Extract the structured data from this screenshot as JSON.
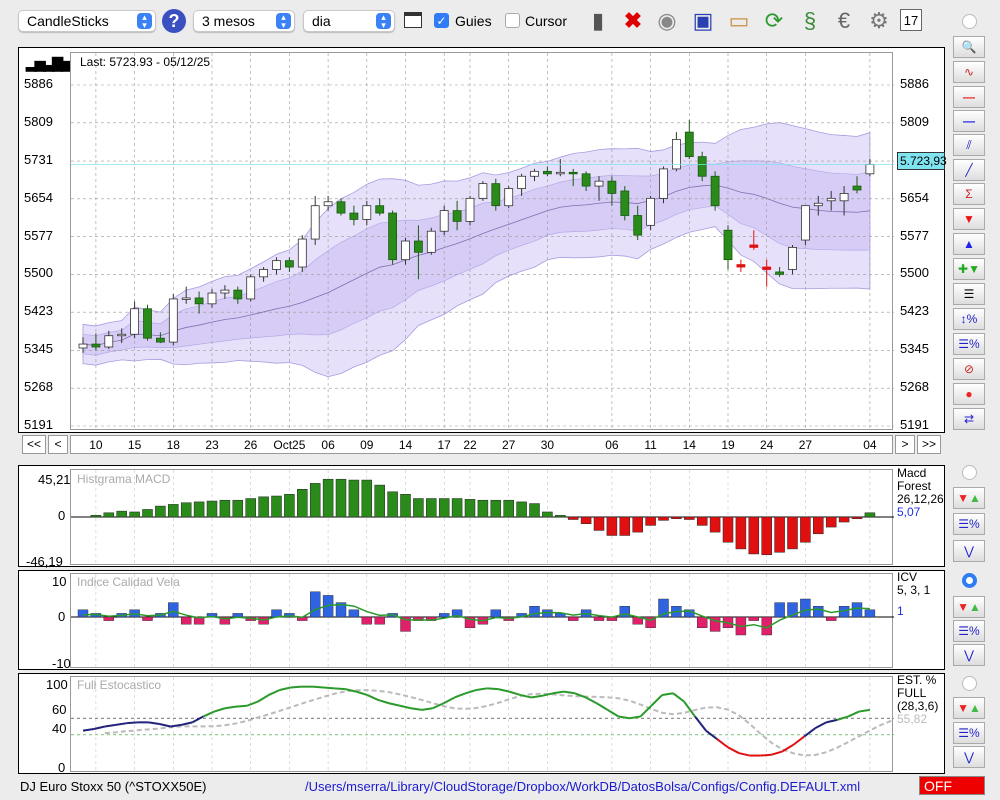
{
  "toolbar": {
    "chart_type": "CandleSticks",
    "period": "3 mesos",
    "interval": "dia",
    "guides_label": "Guies",
    "guides_checked": true,
    "cursor_label": "Cursor",
    "cursor_checked": false,
    "icons": [
      "trash-icon",
      "delete-icon",
      "lamp-icon",
      "save-icon",
      "open-folder-icon",
      "refresh-icon",
      "sync-icon",
      "euro-icon",
      "settings-icon",
      "calendar-icon"
    ]
  },
  "main": {
    "last_label": "Last: 5723.93 - 05/12/25",
    "current_price": "5.723,93",
    "price_ticks": [
      "5886",
      "5809",
      "5731",
      "5654",
      "5577",
      "5500",
      "5423",
      "5345",
      "5268",
      "5191"
    ]
  },
  "nav": {
    "first": "<<",
    "prev": "<",
    "next": ">",
    "last": ">>"
  },
  "chart_data": [
    {
      "type": "candlestick",
      "title": "Last: 5723.93 - 05/12/25",
      "ylim": [
        5191,
        5886
      ],
      "yticks": [
        5886,
        5809,
        5731,
        5654,
        5577,
        5500,
        5423,
        5345,
        5268,
        5191
      ],
      "xticks": [
        {
          "i": 1,
          "label": "10"
        },
        {
          "i": 4,
          "label": "15"
        },
        {
          "i": 7,
          "label": "18"
        },
        {
          "i": 10,
          "label": "23"
        },
        {
          "i": 13,
          "label": "26"
        },
        {
          "i": 16,
          "label": "Oct25"
        },
        {
          "i": 19,
          "label": "06"
        },
        {
          "i": 22,
          "label": "09"
        },
        {
          "i": 25,
          "label": "14"
        },
        {
          "i": 28,
          "label": "17"
        },
        {
          "i": 30,
          "label": "22"
        },
        {
          "i": 33,
          "label": "27"
        },
        {
          "i": 36,
          "label": "30"
        },
        {
          "i": 41,
          "label": "06"
        },
        {
          "i": 44,
          "label": "11"
        },
        {
          "i": 47,
          "label": "14"
        },
        {
          "i": 50,
          "label": "19"
        },
        {
          "i": 53,
          "label": "24"
        },
        {
          "i": 56,
          "label": "27"
        },
        {
          "i": 61,
          "label": "04"
        }
      ],
      "ohlc": [
        [
          5350,
          5372,
          5340,
          5358
        ],
        [
          5358,
          5380,
          5345,
          5352
        ],
        [
          5352,
          5385,
          5348,
          5375
        ],
        [
          5375,
          5390,
          5360,
          5378
        ],
        [
          5378,
          5445,
          5370,
          5430
        ],
        [
          5430,
          5438,
          5365,
          5370
        ],
        [
          5370,
          5382,
          5360,
          5362
        ],
        [
          5362,
          5460,
          5355,
          5450
        ],
        [
          5450,
          5475,
          5440,
          5452
        ],
        [
          5452,
          5465,
          5420,
          5440
        ],
        [
          5440,
          5470,
          5432,
          5462
        ],
        [
          5462,
          5478,
          5450,
          5468
        ],
        [
          5468,
          5475,
          5440,
          5450
        ],
        [
          5450,
          5500,
          5445,
          5495
        ],
        [
          5495,
          5515,
          5485,
          5510
        ],
        [
          5510,
          5535,
          5500,
          5528
        ],
        [
          5528,
          5535,
          5505,
          5515
        ],
        [
          5515,
          5580,
          5505,
          5572
        ],
        [
          5572,
          5660,
          5560,
          5640
        ],
        [
          5640,
          5660,
          5630,
          5648
        ],
        [
          5648,
          5655,
          5620,
          5625
        ],
        [
          5625,
          5640,
          5600,
          5612
        ],
        [
          5612,
          5650,
          5600,
          5640
        ],
        [
          5640,
          5655,
          5620,
          5625
        ],
        [
          5625,
          5630,
          5520,
          5530
        ],
        [
          5530,
          5575,
          5520,
          5568
        ],
        [
          5568,
          5600,
          5490,
          5545
        ],
        [
          5545,
          5595,
          5540,
          5588
        ],
        [
          5588,
          5640,
          5580,
          5630
        ],
        [
          5630,
          5650,
          5590,
          5608
        ],
        [
          5608,
          5660,
          5600,
          5655
        ],
        [
          5655,
          5690,
          5650,
          5685
        ],
        [
          5685,
          5695,
          5630,
          5640
        ],
        [
          5640,
          5680,
          5635,
          5675
        ],
        [
          5675,
          5705,
          5660,
          5700
        ],
        [
          5700,
          5715,
          5690,
          5710
        ],
        [
          5710,
          5720,
          5700,
          5705
        ],
        [
          5705,
          5735,
          5700,
          5708
        ],
        [
          5708,
          5715,
          5680,
          5705
        ],
        [
          5705,
          5710,
          5670,
          5680
        ],
        [
          5680,
          5700,
          5650,
          5690
        ],
        [
          5690,
          5700,
          5640,
          5665
        ],
        [
          5670,
          5680,
          5610,
          5620
        ],
        [
          5620,
          5640,
          5570,
          5580
        ],
        [
          5600,
          5660,
          5590,
          5655
        ],
        [
          5655,
          5720,
          5645,
          5715
        ],
        [
          5715,
          5790,
          5710,
          5775
        ],
        [
          5790,
          5815,
          5735,
          5740
        ],
        [
          5740,
          5750,
          5690,
          5700
        ],
        [
          5700,
          5710,
          5630,
          5640
        ],
        [
          5590,
          5600,
          5510,
          5530
        ],
        [
          5520,
          5530,
          5505,
          5515
        ],
        [
          5560,
          5590,
          5550,
          5555
        ],
        [
          5515,
          5530,
          5475,
          5510
        ],
        [
          5505,
          5515,
          5495,
          5500
        ],
        [
          5510,
          5560,
          5500,
          5555
        ],
        [
          5570,
          5640,
          5560,
          5640
        ],
        [
          5640,
          5660,
          5620,
          5645
        ],
        [
          5650,
          5670,
          5630,
          5655
        ],
        [
          5650,
          5680,
          5620,
          5665
        ],
        [
          5680,
          5700,
          5665,
          5672
        ],
        [
          5705,
          5735,
          5700,
          5724
        ]
      ],
      "red_indices": [
        51,
        52,
        53
      ]
    },
    {
      "type": "bar",
      "title": "Histgrama MACD",
      "name": "Macd Forest",
      "params": "26,12,26",
      "value": "5,07",
      "ylim": [
        -46.19,
        45.21
      ],
      "yticks": [
        "45,21",
        "0",
        "-46,19"
      ],
      "values": [
        0,
        2,
        5,
        7,
        6,
        9,
        13,
        15,
        17,
        18,
        19,
        20,
        20,
        22,
        24,
        25,
        27,
        33,
        40,
        45,
        45,
        44,
        44,
        38,
        30,
        27,
        22,
        22,
        22,
        22,
        21,
        20,
        20,
        20,
        18,
        16,
        6,
        2,
        -3,
        -8,
        -16,
        -22,
        -22,
        -18,
        -10,
        -4,
        -2,
        -3,
        -10,
        -18,
        -30,
        -38,
        -44,
        -45,
        -42,
        -38,
        -30,
        -20,
        -12,
        -6,
        -2,
        5
      ]
    },
    {
      "type": "bar",
      "title": "Indice Calidad Vela",
      "name": "ICV",
      "params": "5, 3, 1",
      "value": "1",
      "ylim": [
        -10,
        10
      ],
      "yticks": [
        "10",
        "0",
        "-10"
      ],
      "values": [
        2,
        1,
        -1,
        1,
        2,
        -1,
        1,
        4,
        -2,
        -2,
        1,
        -2,
        1,
        -1,
        -2,
        2,
        1,
        -1,
        7,
        6,
        4,
        2,
        -2,
        -2,
        1,
        -4,
        -1,
        -1,
        1,
        2,
        -3,
        -2,
        2,
        -1,
        1,
        3,
        2,
        1,
        -1,
        2,
        -1,
        -1,
        3,
        -2,
        -3,
        5,
        3,
        2,
        -3,
        -4,
        -3,
        -5,
        -1,
        -5,
        4,
        4,
        5,
        3,
        -1,
        3,
        4,
        2
      ]
    },
    {
      "type": "line",
      "title": "Full Estocastico",
      "name": "EST. % FULL",
      "params": "(28,3,6)",
      "value": "55,82",
      "ylim": [
        0,
        100
      ],
      "yticks": [
        "100",
        "60",
        "40",
        "0"
      ],
      "k": [
        45,
        47,
        50,
        52,
        54,
        55,
        55,
        53,
        50,
        52,
        55,
        62,
        68,
        72,
        74,
        75,
        80,
        88,
        94,
        97,
        98,
        98,
        97,
        96,
        95,
        92,
        88,
        82,
        78,
        75,
        72,
        70,
        72,
        78,
        85,
        90,
        94,
        96,
        95,
        92,
        88,
        85,
        87,
        90,
        92,
        90,
        85,
        78,
        70,
        62,
        60,
        62,
        75,
        88,
        90,
        80,
        62,
        45,
        35,
        25,
        18,
        15,
        15,
        16,
        20,
        28,
        38,
        48,
        55,
        58,
        62,
        68,
        70
      ]
    }
  ],
  "status": {
    "instrument": "DJ Euro Stoxx 50 (^STOXX50E)",
    "config_path": "/Users/mserra/Library/CloudStorage/Dropbox/WorkDB/DatosBolsa/Configs/Config.DEFAULT.xml",
    "mode": "OFF"
  },
  "colors": {
    "up": "#2a8a1a",
    "down": "#e01010",
    "band": "#cfc6f4",
    "macd_pos": "#2a8a1a",
    "macd_neg": "#e01010",
    "icv_pos": "#2f63e0",
    "icv_neg": "#e0206a"
  }
}
